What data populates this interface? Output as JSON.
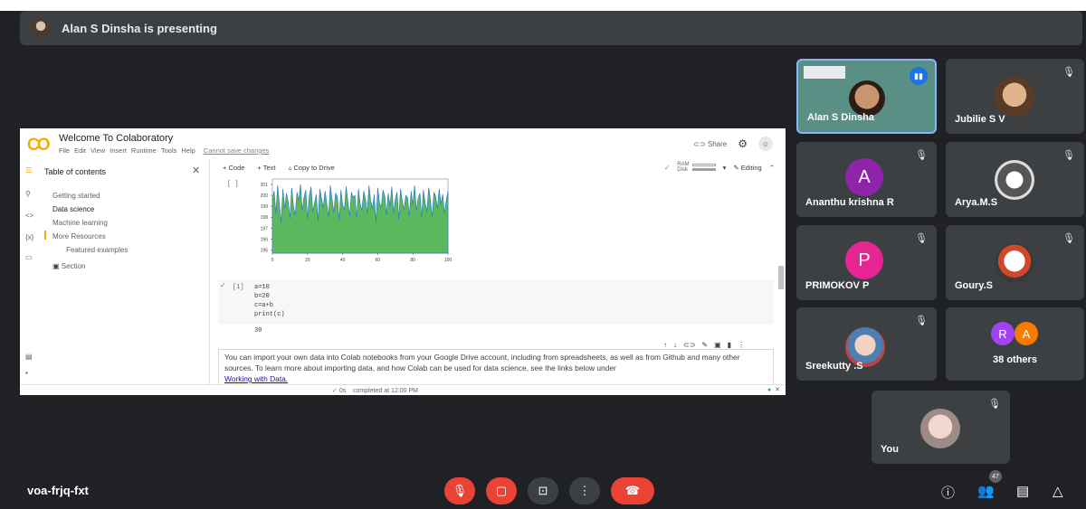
{
  "presenting_banner": {
    "text": "Alan S Dinsha is presenting"
  },
  "colab": {
    "logo": "CO",
    "title": "Welcome To Colaboratory",
    "menu": [
      "File",
      "Edit",
      "View",
      "Insert",
      "Runtime",
      "Tools",
      "Help"
    ],
    "save_warning": "Cannot save changes",
    "share_label": "Share",
    "toolbar": {
      "code": "+ Code",
      "text": "+ Text",
      "copy": "Copy to Drive",
      "ram": "RAM",
      "disk": "Disk",
      "editing": "Editing"
    },
    "toc": {
      "title": "Table of contents",
      "items": [
        "Getting started",
        "Data science",
        "Machine learning",
        "More Resources",
        "Featured examples",
        "Section"
      ]
    },
    "rail_icons": [
      "list-icon",
      "search-icon",
      "code-icon",
      "variables-icon",
      "folder-icon"
    ],
    "cell_bracket": "[ ]",
    "code_cell": {
      "index": "[1]",
      "lines": [
        "a=10",
        "b=20",
        "c=a+b",
        "print(c)"
      ],
      "output": "30"
    },
    "text_cell": {
      "text": "You can import your own data into Colab notebooks from your Google Drive account, including from spreadsheets, as well as from Github and many other sources. To learn more about importing data, and how Colab can be used for data science, see the links below under",
      "link": "Working with Data."
    },
    "status": {
      "time": "0s",
      "message": "completed at 12:00 PM"
    }
  },
  "chart_data": {
    "type": "area",
    "x_ticks": [
      "0",
      "20",
      "40",
      "60",
      "80",
      "100"
    ],
    "y_ticks": [
      "201",
      "200",
      "199",
      "198",
      "197",
      "196",
      "195"
    ],
    "xlim": [
      0,
      100
    ],
    "ylim": [
      194.7,
      201.5
    ],
    "values": [
      199.6,
      200.4,
      198.3,
      200.9,
      199.1,
      197.5,
      200.6,
      198.8,
      200.2,
      199.4,
      197.9,
      200.7,
      199.0,
      198.2,
      200.3,
      199.5,
      201.0,
      198.6,
      199.8,
      200.5,
      197.8,
      199.9,
      200.8,
      198.5,
      199.3,
      200.1,
      197.6,
      200.6,
      199.7,
      198.9,
      200.4,
      199.2,
      198.0,
      200.9,
      199.6,
      198.4,
      200.2,
      199.9,
      197.7,
      200.5,
      199.1,
      198.7,
      200.8,
      199.4,
      198.1,
      200.3,
      199.8,
      200.0,
      197.9,
      200.6,
      199.2,
      198.6,
      200.4,
      199.7,
      198.3,
      200.9,
      199.5,
      198.8,
      200.1,
      197.5,
      200.7,
      199.3,
      198.9,
      200.5,
      199.9,
      198.2,
      200.2,
      199.0,
      200.8,
      198.4,
      199.6,
      200.3,
      197.8,
      200.6,
      199.4,
      198.7,
      200.0,
      199.8,
      198.1,
      200.4,
      199.1,
      200.9,
      198.6,
      199.7,
      200.2,
      197.9,
      200.5,
      199.3,
      198.5,
      200.7,
      199.6,
      198.0,
      200.3,
      199.9,
      198.8,
      200.6,
      199.2,
      200.1,
      198.3,
      199.5,
      200.4
    ]
  },
  "participants": [
    {
      "name": "Alan S Dinsha",
      "kind": "video",
      "speaking": true
    },
    {
      "name": "Jubilie S V",
      "kind": "photo",
      "muted": true
    },
    {
      "name": "Ananthu krishna R",
      "kind": "letter",
      "letter": "A",
      "color": "#8e24aa",
      "muted": true
    },
    {
      "name": "Arya.M.S",
      "kind": "photo",
      "muted": true
    },
    {
      "name": "PRIMOKOV P",
      "kind": "letter",
      "letter": "P",
      "color": "#e52592",
      "muted": true
    },
    {
      "name": "Goury.S",
      "kind": "photo",
      "muted": true
    },
    {
      "name": "Sreekutty .S",
      "kind": "photo",
      "muted": true
    },
    {
      "name": "38 others",
      "kind": "group",
      "letters": [
        "R",
        "A"
      ],
      "colors": [
        "#a142f4",
        "#f57c00"
      ]
    },
    {
      "name": "You",
      "kind": "photo",
      "muted": true
    }
  ],
  "meeting_code": "voa-frjq-fxt",
  "controls": [
    "mic-off-icon",
    "camera-off-icon",
    "present-icon",
    "more-icon",
    "end-call-icon"
  ],
  "people_count": "47",
  "right_icons": [
    "info-icon",
    "people-icon",
    "chat-icon",
    "activities-icon"
  ],
  "glyphs": {
    "mute": "🎙",
    "close": "✕",
    "check": "✓"
  }
}
